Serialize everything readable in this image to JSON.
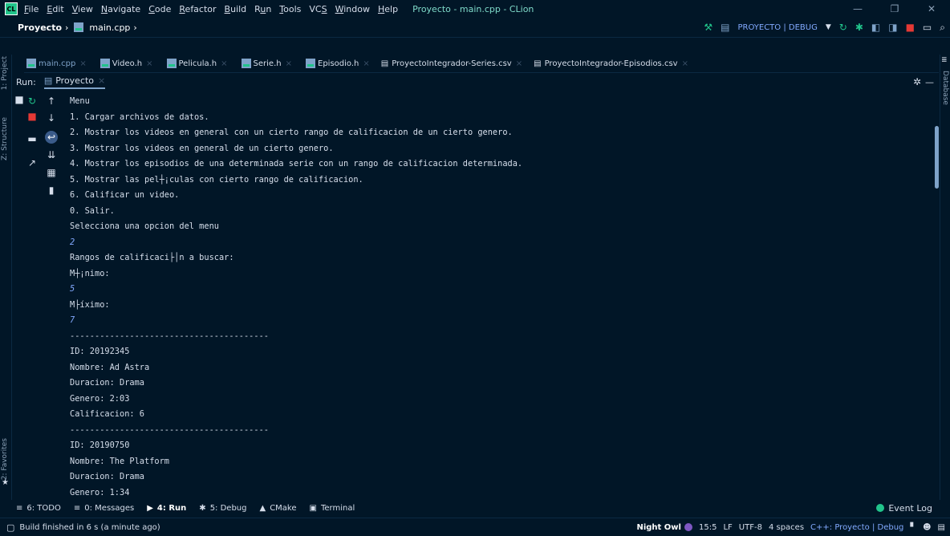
{
  "menubar": {
    "logo": "CL",
    "items": [
      "File",
      "Edit",
      "View",
      "Navigate",
      "Code",
      "Refactor",
      "Build",
      "Run",
      "Tools",
      "VCS",
      "Window",
      "Help"
    ],
    "window_title": "Proyecto - main.cpp - CLion"
  },
  "navbar": {
    "project": "Proyecto",
    "file": "main.cpp",
    "run_config": "PROYECTO | DEBUG"
  },
  "left_strip": {
    "project": "1: Project",
    "structure": "Z: Structure",
    "favorites": "2: Favorites"
  },
  "right_strip": {
    "database": "Database"
  },
  "tabs": [
    {
      "label": "main.cpp"
    },
    {
      "label": "Video.h"
    },
    {
      "label": "Pelicula.h"
    },
    {
      "label": "Serie.h"
    },
    {
      "label": "Episodio.h"
    },
    {
      "label": "ProyectoIntegrador-Series.csv"
    },
    {
      "label": "ProyectoIntegrador-Episodios.csv"
    }
  ],
  "run": {
    "label": "Run:",
    "tab": "Proyecto"
  },
  "console": [
    {
      "text": "Menu",
      "input": false
    },
    {
      "text": "1. Cargar archivos de datos.",
      "input": false
    },
    {
      "text": "2. Mostrar los videos en general con un cierto rango de calificacion de un cierto genero.",
      "input": false
    },
    {
      "text": "3. Mostrar los videos en general de un cierto genero.",
      "input": false
    },
    {
      "text": "4. Mostrar los episodios de una determinada serie con un rango de calificacion determinada.",
      "input": false
    },
    {
      "text": "5. Mostrar las pel┼¡culas con cierto rango de calificacion.",
      "input": false
    },
    {
      "text": "6. Calificar un video.",
      "input": false
    },
    {
      "text": "0. Salir.",
      "input": false
    },
    {
      "text": "Selecciona una opcion del menu",
      "input": false
    },
    {
      "text": "2",
      "input": true
    },
    {
      "text": "Rangos de calificaci├│n a buscar:",
      "input": false
    },
    {
      "text": "M┼¡nimo:",
      "input": false
    },
    {
      "text": "5",
      "input": true
    },
    {
      "text": "M├íximo:",
      "input": false
    },
    {
      "text": "7",
      "input": true
    },
    {
      "text": "----------------------------------------",
      "input": false
    },
    {
      "text": "ID: 20192345",
      "input": false
    },
    {
      "text": "Nombre: Ad Astra",
      "input": false
    },
    {
      "text": "Duracion: Drama",
      "input": false
    },
    {
      "text": "Genero: 2:03",
      "input": false
    },
    {
      "text": "Calificacion: 6",
      "input": false
    },
    {
      "text": "----------------------------------------",
      "input": false
    },
    {
      "text": "ID: 20190750",
      "input": false
    },
    {
      "text": "Nombre: The Platform",
      "input": false
    },
    {
      "text": "Duracion: Drama",
      "input": false
    },
    {
      "text": "Genero: 1:34",
      "input": false
    }
  ],
  "tool_windows": [
    {
      "label": "6: TODO",
      "icon": "list-icon",
      "active": false
    },
    {
      "label": "0: Messages",
      "icon": "messages-icon",
      "active": false
    },
    {
      "label": "4: Run",
      "icon": "run-icon",
      "active": true
    },
    {
      "label": "5: Debug",
      "icon": "debug-icon",
      "active": false
    },
    {
      "label": "CMake",
      "icon": "cmake-icon",
      "active": false
    },
    {
      "label": "Terminal",
      "icon": "terminal-icon",
      "active": false
    }
  ],
  "event_log": "Event Log",
  "status": {
    "message": "Build finished in 6 s (a minute ago)",
    "theme": "Night Owl",
    "position": "15:5",
    "line_sep": "LF",
    "encoding": "UTF-8",
    "indent": "4 spaces",
    "context": "C++: Proyecto | Debug"
  },
  "colors": {
    "background": "#011627",
    "accent": "#7fa3c9",
    "input_text": "#82aaff",
    "green": "#21c48b"
  }
}
